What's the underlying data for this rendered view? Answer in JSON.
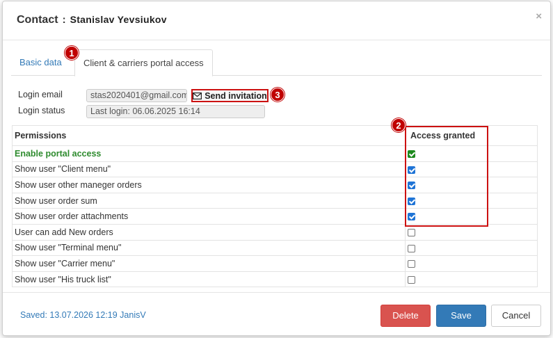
{
  "header": {
    "title_label": "Contact",
    "separator": ":",
    "contact_name": "Stanislav Yevsiukov",
    "close_glyph": "×"
  },
  "tabs": [
    {
      "label": "Basic data",
      "active": false
    },
    {
      "label": "Client & carriers portal access",
      "active": true
    }
  ],
  "callouts": {
    "one": "1",
    "two": "2",
    "three": "3"
  },
  "login": {
    "email_label": "Login email",
    "email_value": "stas2020401@gmail.com",
    "send_invitation_label": "Send invitation",
    "status_label": "Login status",
    "status_value": "Last login: 06.06.2025 16:14"
  },
  "permissions": {
    "col_permissions": "Permissions",
    "col_access": "Access granted",
    "rows": [
      {
        "label": "Enable portal access",
        "checked": true
      },
      {
        "label": "Show user \"Client menu\"",
        "checked": true
      },
      {
        "label": "Show user other maneger orders",
        "checked": true
      },
      {
        "label": "Show user order sum",
        "checked": true
      },
      {
        "label": "Show user order attachments",
        "checked": true
      },
      {
        "label": "User can add New orders",
        "checked": false
      },
      {
        "label": "Show user \"Terminal menu\"",
        "checked": false
      },
      {
        "label": "Show user \"Carrier menu\"",
        "checked": false
      },
      {
        "label": "Show user \"His truck list\"",
        "checked": false
      }
    ]
  },
  "footer": {
    "saved_text": "Saved: 13.07.2026 12:19 JanisV",
    "delete_label": "Delete",
    "save_label": "Save",
    "cancel_label": "Cancel"
  },
  "colors": {
    "primary": "#337ab7",
    "danger": "#d9534f",
    "highlight_red": "#cc1111",
    "enable_green": "#2e8b2e"
  }
}
